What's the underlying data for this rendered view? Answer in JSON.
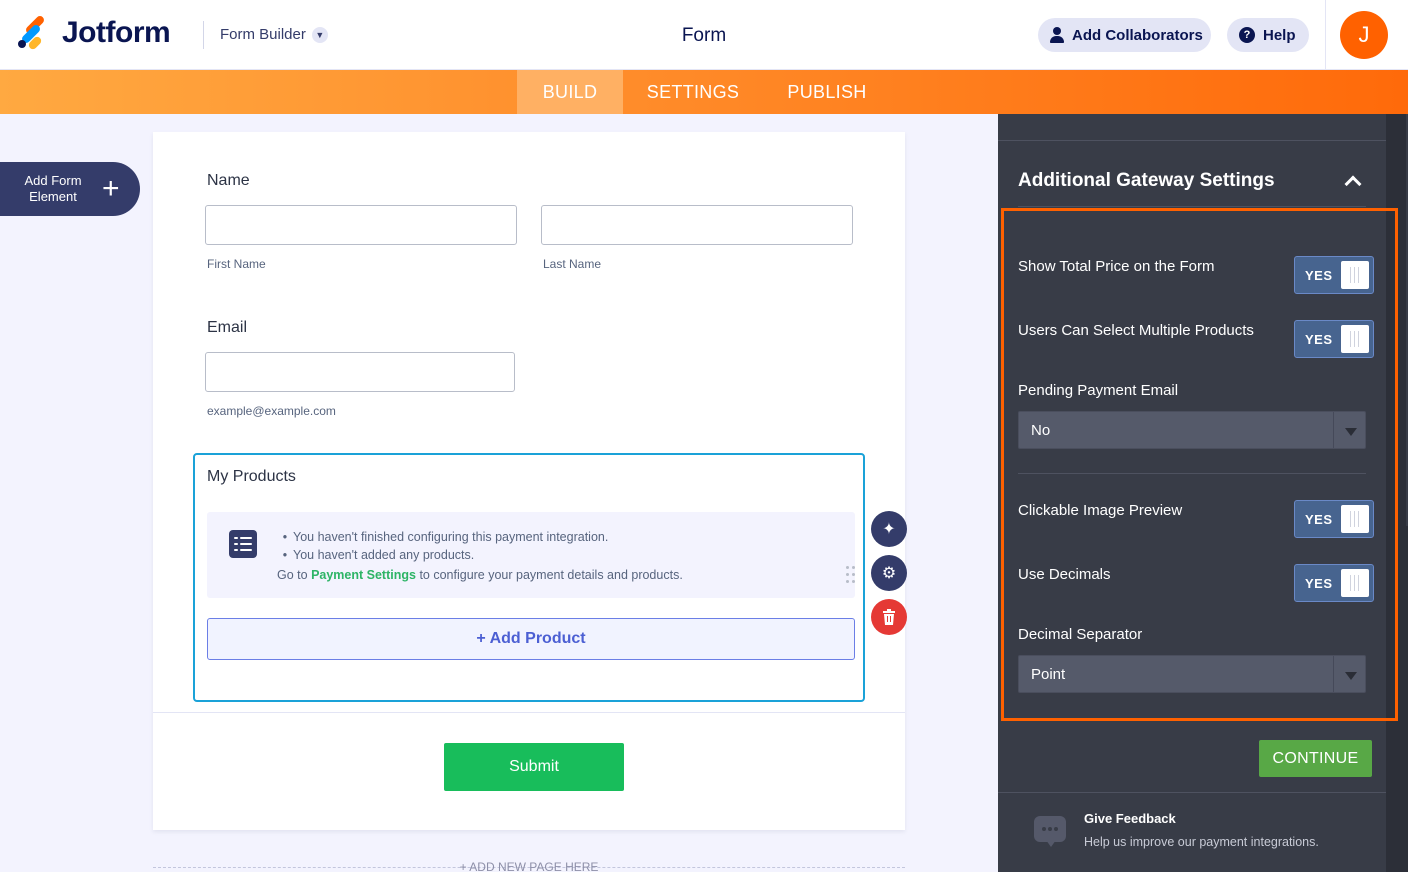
{
  "header": {
    "logo_text": "Jotform",
    "builder_label": "Form Builder",
    "page_title": "Form",
    "collaborators_label": "Add Collaborators",
    "help_label": "Help",
    "avatar_initial": "J"
  },
  "nav": {
    "tabs": [
      {
        "label": "BUILD",
        "active": true
      },
      {
        "label": "SETTINGS",
        "active": false
      },
      {
        "label": "PUBLISH",
        "active": false
      }
    ]
  },
  "sidebar": {
    "add_element_label": "Add Form Element"
  },
  "form": {
    "name": {
      "label": "Name",
      "first_sublabel": "First Name",
      "last_sublabel": "Last Name",
      "first_value": "",
      "last_value": ""
    },
    "email": {
      "label": "Email",
      "sublabel": "example@example.com",
      "value": ""
    },
    "products": {
      "label": "My Products",
      "notices": [
        "You haven't finished configuring this payment integration.",
        "You haven't added any products."
      ],
      "go_prefix": "Go to",
      "go_link": "Payment Settings",
      "go_suffix": "to configure your payment details and products.",
      "add_product_label": "+ Add Product"
    },
    "submit_label": "Submit",
    "add_page_label": "+ ADD NEW PAGE HERE"
  },
  "panel": {
    "title": "Additional Gateway Settings",
    "settings": [
      {
        "label": "Show Total Price on the Form",
        "type": "toggle",
        "value": "YES"
      },
      {
        "label": "Users Can Select Multiple Products",
        "type": "toggle",
        "value": "YES"
      },
      {
        "label": "Pending Payment Email",
        "type": "select",
        "value": "No"
      },
      {
        "label": "Clickable Image Preview",
        "type": "toggle",
        "value": "YES"
      },
      {
        "label": "Use Decimals",
        "type": "toggle",
        "value": "YES"
      },
      {
        "label": "Decimal Separator",
        "type": "select",
        "value": "Point"
      }
    ],
    "continue_label": "CONTINUE",
    "feedback_title": "Give Feedback",
    "feedback_sub": "Help us improve our payment integrations."
  },
  "colors": {
    "brand_orange": "#ff6100",
    "panel_bg": "#383c47",
    "submit_green": "#18bd5b",
    "continue_green": "#58a846",
    "highlight_border": "#ff6100"
  }
}
